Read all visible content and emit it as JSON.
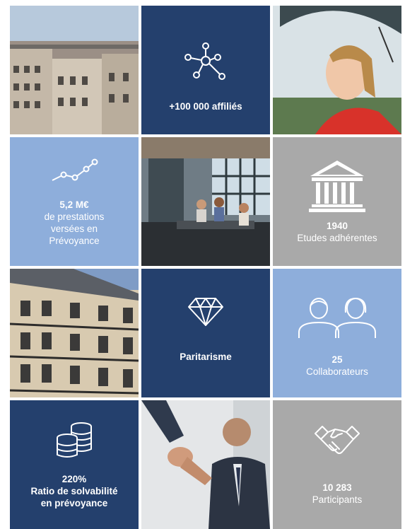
{
  "tiles": {
    "affilies": {
      "text": "+100 000 affiliés"
    },
    "prestations": {
      "value": "5,2 M€",
      "line1": "de prestations",
      "line2": "versées en",
      "line3": "Prévoyance"
    },
    "etudes": {
      "value": "1940",
      "label": "Etudes adhérentes"
    },
    "paritarisme": {
      "text": "Paritarisme"
    },
    "collaborateurs": {
      "value": "25",
      "label": "Collaborateurs"
    },
    "solvabilite": {
      "value": "220%",
      "line1": "Ratio de solvabilité",
      "line2": "en prévoyance"
    },
    "participants": {
      "value": "10 283",
      "label": "Participants"
    }
  },
  "colors": {
    "navy": "#24406d",
    "light_blue": "#8eaedb",
    "grey": "#a9a9a9"
  },
  "icons": [
    "network-icon",
    "line-chart-icon",
    "bank-building-icon",
    "diamond-icon",
    "people-icon",
    "coins-icon",
    "handshake-icon"
  ]
}
